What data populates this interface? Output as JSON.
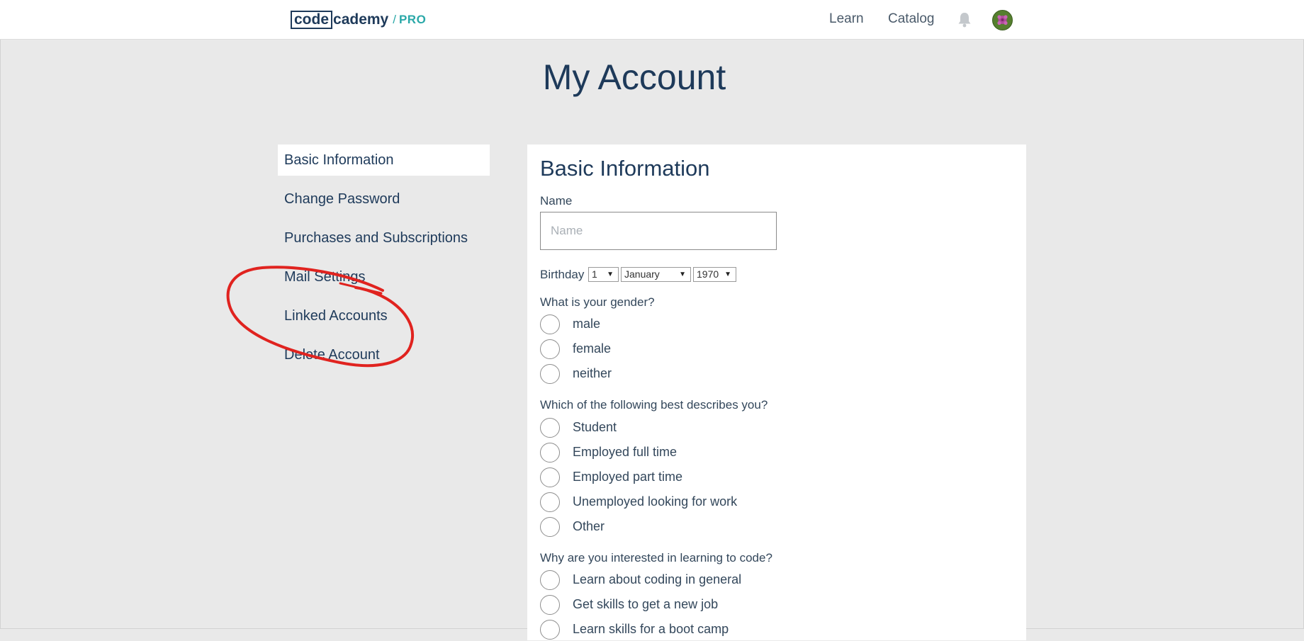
{
  "header": {
    "logo": {
      "code": "code",
      "cademy": "cademy",
      "separator": "/",
      "pro": "PRO"
    },
    "nav": {
      "learn": "Learn",
      "catalog": "Catalog"
    },
    "icons": {
      "notifications": "bell-icon",
      "avatar": "user-avatar"
    }
  },
  "page": {
    "title": "My Account"
  },
  "sidebar": {
    "items": [
      {
        "label": "Basic Information",
        "active": true
      },
      {
        "label": "Change Password",
        "active": false
      },
      {
        "label": "Purchases and Subscriptions",
        "active": false
      },
      {
        "label": "Mail Settings",
        "active": false
      },
      {
        "label": "Linked Accounts",
        "active": false
      },
      {
        "label": "Delete Account",
        "active": false
      }
    ]
  },
  "annotation": {
    "type": "hand-drawn red ellipse",
    "color": "#e0231f"
  },
  "form": {
    "title": "Basic Information",
    "name": {
      "label": "Name",
      "placeholder": "Name",
      "value": ""
    },
    "birthday": {
      "label": "Birthday",
      "day": "1",
      "month": "January",
      "year": "1970"
    },
    "gender": {
      "question": "What is your gender?",
      "options": [
        "male",
        "female",
        "neither"
      ]
    },
    "occupation": {
      "question": "Which of the following best describes you?",
      "options": [
        "Student",
        "Employed full time",
        "Employed part time",
        "Unemployed looking for work",
        "Other"
      ]
    },
    "interest": {
      "question": "Why are you interested in learning to code?",
      "options": [
        "Learn about coding in general",
        "Get skills to get a new job",
        "Learn skills for a boot camp"
      ]
    }
  },
  "colors": {
    "brand_navy": "#1e3a5a",
    "brand_teal": "#2aa8a8",
    "background": "#e9e9e9"
  }
}
